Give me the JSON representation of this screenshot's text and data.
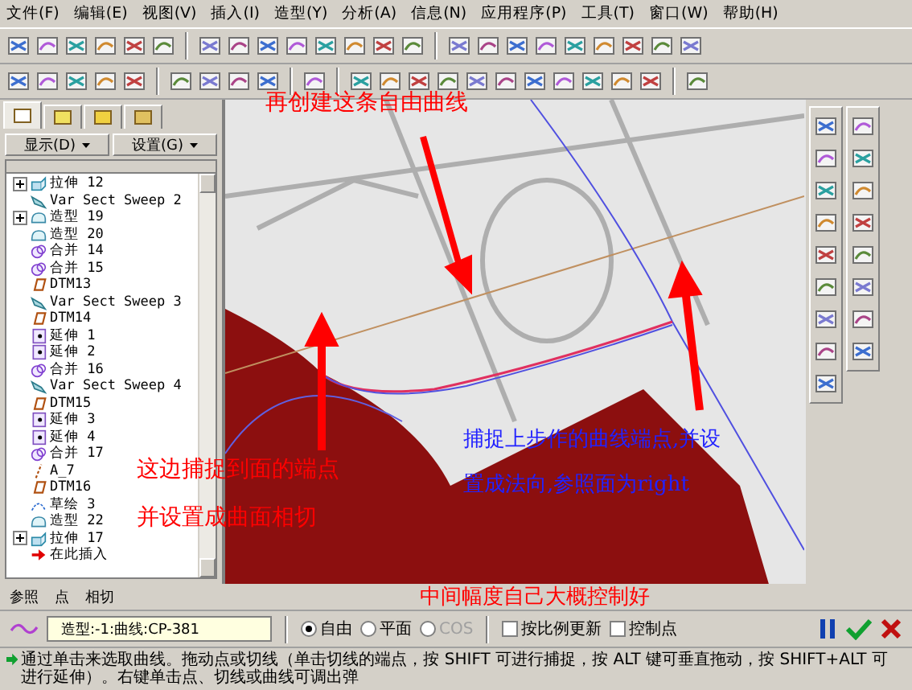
{
  "menu": [
    "文件(F)",
    "编辑(E)",
    "视图(V)",
    "插入(I)",
    "造型(Y)",
    "分析(A)",
    "信息(N)",
    "应用程序(P)",
    "工具(T)",
    "窗口(W)",
    "帮助(H)"
  ],
  "model_tree": {
    "tabs": [
      {
        "selected": true
      },
      {
        "selected": false
      },
      {
        "selected": false
      },
      {
        "selected": false
      }
    ],
    "buttons": [
      "显示(D)",
      "设置(G)"
    ],
    "items": [
      {
        "label": "拉伸 12",
        "kind": "extrude",
        "collapsed": true
      },
      {
        "label": "Var Sect Sweep 2",
        "kind": "sweep",
        "collapsed": false
      },
      {
        "label": "造型 19",
        "kind": "style",
        "collapsed": true
      },
      {
        "label": "造型 20",
        "kind": "style",
        "collapsed": false
      },
      {
        "label": "合并 14",
        "kind": "merge",
        "collapsed": false
      },
      {
        "label": "合并 15",
        "kind": "merge",
        "collapsed": false
      },
      {
        "label": "DTM13",
        "kind": "datum",
        "collapsed": false
      },
      {
        "label": "Var Sect Sweep 3",
        "kind": "sweep",
        "collapsed": false
      },
      {
        "label": "DTM14",
        "kind": "datum",
        "collapsed": false
      },
      {
        "label": "延伸 1",
        "kind": "extend",
        "collapsed": false
      },
      {
        "label": "延伸 2",
        "kind": "extend",
        "collapsed": false
      },
      {
        "label": "合并 16",
        "kind": "merge",
        "collapsed": false
      },
      {
        "label": "Var Sect Sweep 4",
        "kind": "sweep",
        "collapsed": false
      },
      {
        "label": "DTM15",
        "kind": "datum",
        "collapsed": false
      },
      {
        "label": "延伸 3",
        "kind": "extend",
        "collapsed": false
      },
      {
        "label": "延伸 4",
        "kind": "extend",
        "collapsed": false
      },
      {
        "label": "合并 17",
        "kind": "merge",
        "collapsed": false
      },
      {
        "label": "A_7",
        "kind": "axis",
        "collapsed": false
      },
      {
        "label": "DTM16",
        "kind": "datum",
        "collapsed": false
      },
      {
        "label": "草绘 3",
        "kind": "sketch",
        "collapsed": false
      },
      {
        "label": "造型 22",
        "kind": "style",
        "collapsed": false
      },
      {
        "label": "拉伸 17",
        "kind": "extrude",
        "collapsed": true
      },
      {
        "label": "在此插入",
        "kind": "insert",
        "collapsed": false
      }
    ]
  },
  "annotations": [
    {
      "text": "再创建这条自由曲线",
      "color": "#ff0000"
    },
    {
      "text": "这边捕捉到面的端点",
      "color": "#ff0000"
    },
    {
      "text": "并设置成曲面相切",
      "color": "#ff0000"
    },
    {
      "text": "捕捉上步作的曲线端点,并设",
      "color": "#2222ff"
    },
    {
      "text": "置成法向,参照面为right",
      "color": "#2222ff"
    },
    {
      "text": "中间幅度自己大概控制好",
      "color": "#ff0000"
    }
  ],
  "dashboard": {
    "tabs": [
      "参照",
      "点",
      "相切"
    ],
    "field": {
      "value": "造型:-1:曲线:CP-381"
    },
    "options": [
      {
        "label": "自由",
        "selected": true,
        "disabled": false
      },
      {
        "label": "平面",
        "selected": false,
        "disabled": false
      },
      {
        "label": "COS",
        "selected": false,
        "disabled": true
      }
    ],
    "checkboxes": [
      {
        "label": "按比例更新",
        "checked": false
      },
      {
        "label": "控制点",
        "checked": false
      }
    ]
  },
  "message": "通过单击来选取曲线。拖动点或切线（单击切线的端点，按 SHIFT 可进行捕捉，按 ALT 键可垂直拖动，按 SHIFT+ALT 可进行延伸）。右键单击点、切线或曲线可调出弹"
}
